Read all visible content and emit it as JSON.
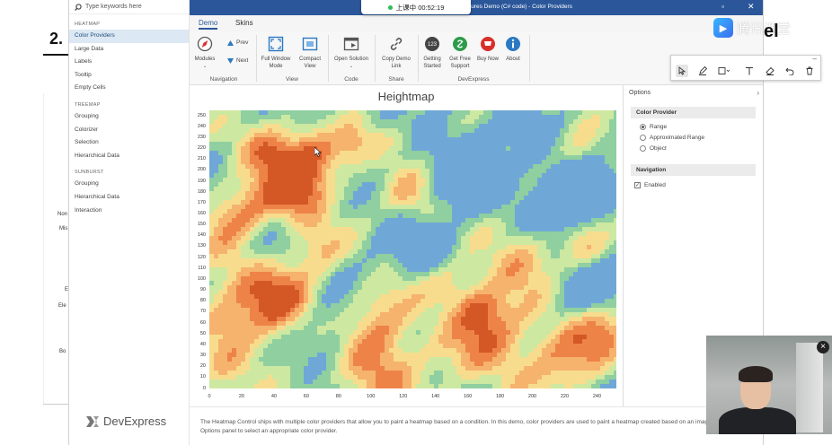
{
  "background": {
    "slide_title_fragment": "2.",
    "side_fragments": [
      "Non",
      "Mis",
      "E",
      "Ele",
      "Bo"
    ],
    "brand_fragment": "el"
  },
  "app": {
    "window_title": "...tures Demo (C# code) - Color Providers",
    "window_controls": {
      "restore": "▫",
      "close": "✕"
    },
    "search_placeholder": "Type keywords here",
    "sidebar": [
      {
        "group": "HEATMAP",
        "items": [
          {
            "label": "Color Providers",
            "selected": true
          },
          {
            "label": "Large Data"
          },
          {
            "label": "Labels"
          },
          {
            "label": "Tooltip"
          },
          {
            "label": "Empty Cells"
          }
        ]
      },
      {
        "group": "TREEMAP",
        "items": [
          {
            "label": "Grouping"
          },
          {
            "label": "Colorizer"
          },
          {
            "label": "Selection"
          },
          {
            "label": "Hierarchical Data"
          }
        ]
      },
      {
        "group": "SUNBURST",
        "items": [
          {
            "label": "Grouping"
          },
          {
            "label": "Hierarchical Data"
          },
          {
            "label": "Interaction"
          }
        ]
      }
    ],
    "logo_text": "DevExpress",
    "ribbon_tabs": [
      {
        "label": "Demo",
        "active": true
      },
      {
        "label": "Skins"
      }
    ],
    "ribbon": {
      "modules": "Modules",
      "prev": "Prev",
      "next": "Next",
      "full_window_mode": "Full Window Mode",
      "compact_view": "Compact View",
      "open_solution": "Open Solution",
      "copy_demo_link": "Copy Demo Link",
      "getting_started": "Getting Started",
      "get_free_support": "Get Free Support",
      "buy_now": "Buy Now",
      "about": "About",
      "groups": [
        "Navigation",
        "View",
        "Code",
        "Share",
        "DevExpress"
      ]
    },
    "options": {
      "header": "Options",
      "color_provider_title": "Color Provider",
      "color_provider_options": [
        {
          "label": "Range",
          "checked": true
        },
        {
          "label": "Approximated Range",
          "checked": false
        },
        {
          "label": "Object",
          "checked": false
        }
      ],
      "navigation_title": "Navigation",
      "enabled_label": "Enabled",
      "enabled_checked": true
    },
    "description": "The Heatmap Control ships with multiple color providers that allow you to paint a heatmap based on a condition. In this demo, color providers are used to paint a heatmap created based on an image. Use the Options panel to select an appropriate color provider."
  },
  "chart_data": {
    "type": "heatmap",
    "title": "Heightmap",
    "xlabel": "",
    "ylabel": "",
    "xlim": [
      0,
      252
    ],
    "ylim": [
      0,
      255
    ],
    "x_ticks": [
      0,
      20,
      40,
      60,
      80,
      100,
      120,
      140,
      160,
      180,
      200,
      220,
      240
    ],
    "y_ticks": [
      0,
      10,
      20,
      30,
      40,
      50,
      60,
      70,
      80,
      90,
      100,
      110,
      120,
      130,
      140,
      150,
      160,
      170,
      180,
      190,
      200,
      210,
      220,
      230,
      240,
      250
    ],
    "color_scale": [
      "#6fa8d6",
      "#8fcfa0",
      "#cde8a0",
      "#f8dc8e",
      "#f5b36e",
      "#ee8348",
      "#d35826"
    ],
    "grid": false,
    "legend": "none"
  },
  "overlay": {
    "recording_time": "上课中 00:52:19",
    "brand": "腾讯课堂",
    "annotation_tools": [
      "pointer",
      "pen",
      "rectangle",
      "text",
      "eraser",
      "undo",
      "delete"
    ],
    "close_glyph": "×"
  }
}
